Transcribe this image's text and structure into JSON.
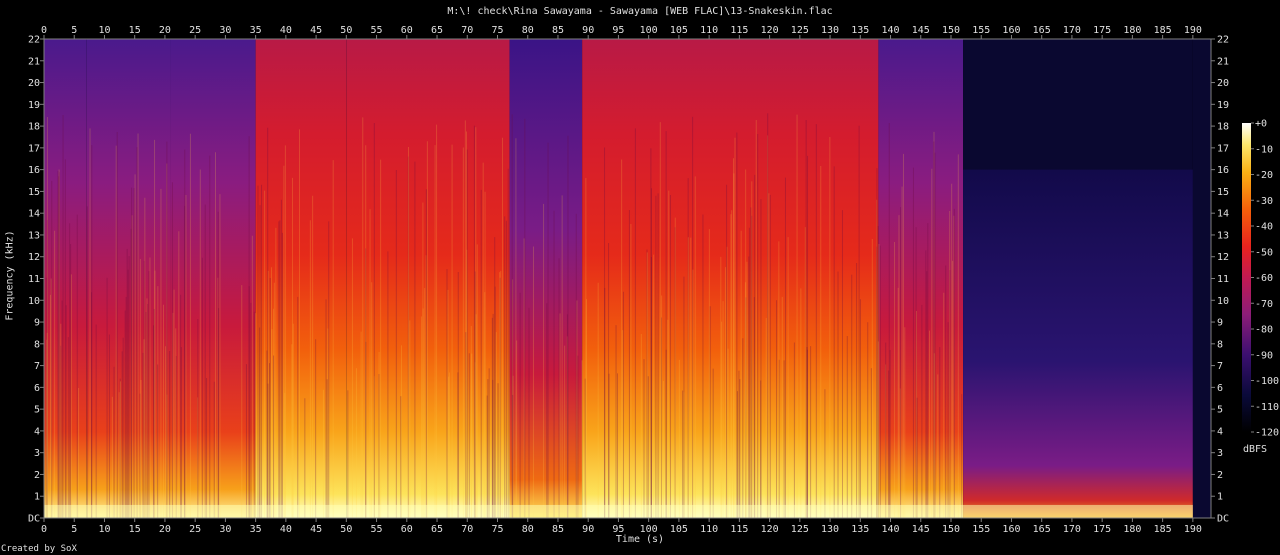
{
  "chart_data": {
    "type": "heatmap",
    "title": "M:\\! check\\Rina Sawayama - Sawayama [WEB FLAC]\\13-Snakeskin.flac",
    "xlabel": "Time (s)",
    "ylabel": "Frequency (kHz)",
    "x_ticks": [
      "0",
      "5",
      "10",
      "15",
      "20",
      "25",
      "30",
      "35",
      "40",
      "45",
      "50",
      "55",
      "60",
      "65",
      "70",
      "75",
      "80",
      "85",
      "90",
      "95",
      "100",
      "105",
      "110",
      "115",
      "120",
      "125",
      "130",
      "135",
      "140",
      "145",
      "150",
      "155",
      "160",
      "165",
      "170",
      "175",
      "180",
      "185",
      "190"
    ],
    "y_ticks": [
      "DC",
      "1",
      "2",
      "3",
      "4",
      "5",
      "6",
      "7",
      "8",
      "9",
      "10",
      "11",
      "12",
      "13",
      "14",
      "15",
      "16",
      "17",
      "18",
      "19",
      "20",
      "21",
      "22"
    ],
    "xlim": [
      0,
      193
    ],
    "ylim": [
      0,
      22
    ],
    "colorbar": {
      "unit": "dBFS",
      "range": [
        -120,
        0
      ],
      "ticks": [
        "+0",
        "-10",
        "-20",
        "-30",
        "-40",
        "-50",
        "-60",
        "-70",
        "-80",
        "-90",
        "-100",
        "-110",
        "-120"
      ]
    },
    "sections": [
      {
        "start": 0,
        "end": 7,
        "level": "moderate",
        "cutoff_khz": 22
      },
      {
        "start": 7,
        "end": 21,
        "level": "moderate",
        "cutoff_khz": 22
      },
      {
        "start": 21,
        "end": 35,
        "level": "moderate",
        "cutoff_khz": 22
      },
      {
        "start": 35,
        "end": 50,
        "level": "loud",
        "cutoff_khz": 22
      },
      {
        "start": 50,
        "end": 77,
        "level": "loud",
        "cutoff_khz": 22
      },
      {
        "start": 77,
        "end": 89,
        "level": "quiet",
        "cutoff_khz": 22
      },
      {
        "start": 89,
        "end": 138,
        "level": "loud",
        "cutoff_khz": 22
      },
      {
        "start": 138,
        "end": 152,
        "level": "moderate",
        "cutoff_khz": 22
      },
      {
        "start": 152,
        "end": 190,
        "level": "fade",
        "cutoff_khz": 16
      },
      {
        "start": 190,
        "end": 193,
        "level": "silence",
        "cutoff_khz": 0
      }
    ],
    "colors": {
      "background": "#000000",
      "text": "#e0e0e0",
      "axis": "#808080"
    }
  },
  "footer": "Created by SoX"
}
